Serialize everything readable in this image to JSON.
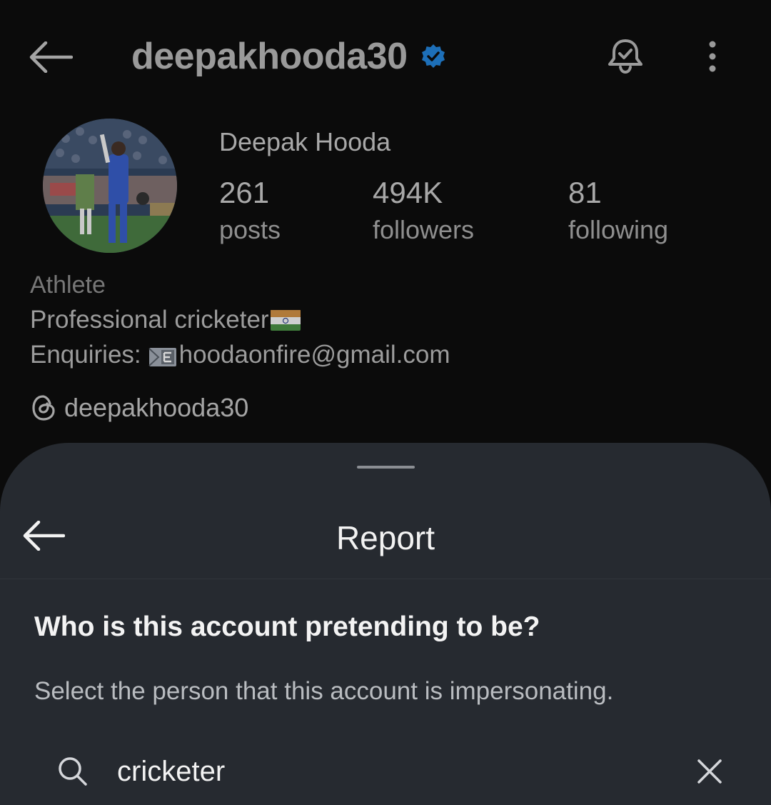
{
  "header": {
    "username": "deepakhooda30",
    "verified_color": "#1d9bf0"
  },
  "profile": {
    "full_name": "Deepak Hooda",
    "stats": [
      {
        "count": "261",
        "label": "posts"
      },
      {
        "count": "494K",
        "label": "followers"
      },
      {
        "count": "81",
        "label": "following"
      }
    ],
    "category": "Athlete",
    "bio_line_1": "Professional cricketer",
    "bio_line_2_prefix": "Enquiries:",
    "bio_email": "hoodaonfire@gmail.com",
    "threads_handle": "deepakhooda30"
  },
  "report_sheet": {
    "title": "Report",
    "question": "Who is this account pretending to be?",
    "subtext": "Select the person that this account is impersonating.",
    "search": {
      "value": "cricketer"
    }
  },
  "colors": {
    "background": "#0b0b0b",
    "sheet": "#262a30",
    "verified_badge": "#1d9bf0"
  },
  "icons": [
    "back-arrow-icon",
    "verified-badge-icon",
    "bell-icon",
    "more-vertical-icon",
    "india-flag-icon",
    "email-icon",
    "threads-icon",
    "search-icon",
    "close-icon"
  ]
}
